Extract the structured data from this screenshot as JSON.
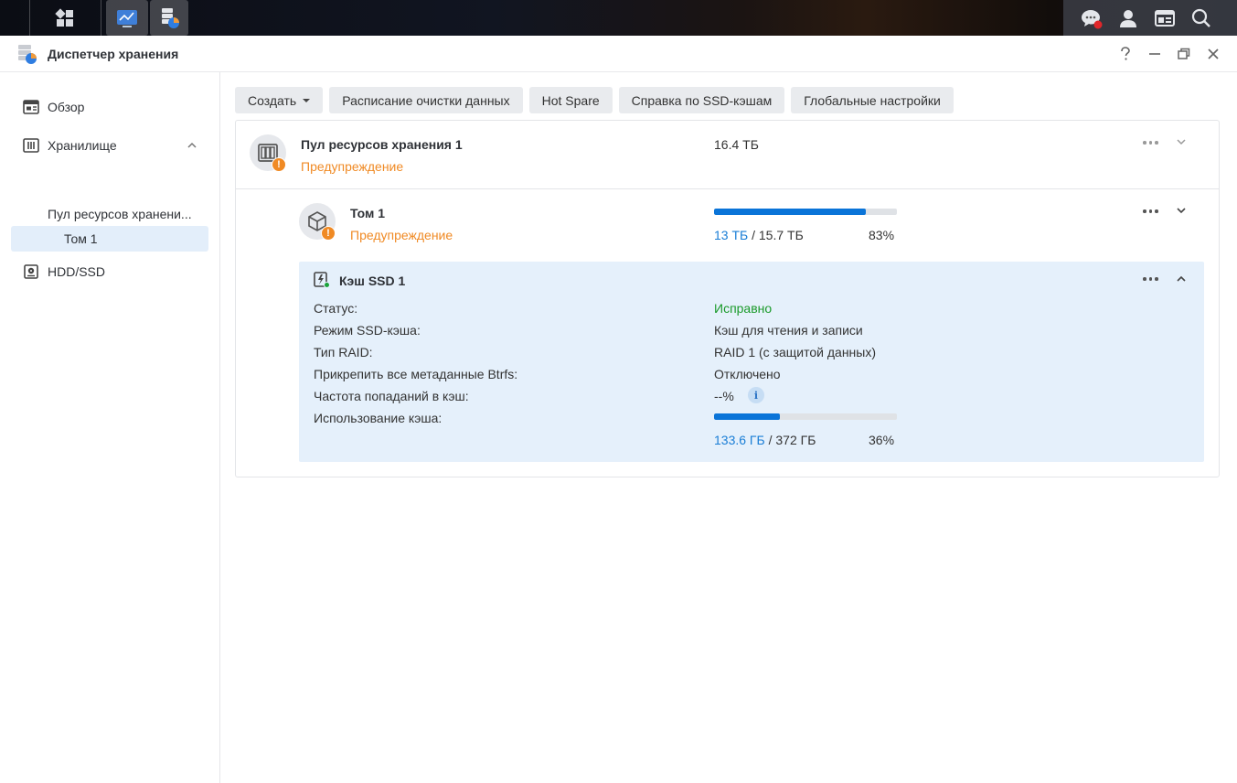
{
  "window": {
    "title": "Диспетчер хранения"
  },
  "sidebar": {
    "items": [
      {
        "label": "Обзор"
      },
      {
        "label": "Хранилище"
      },
      {
        "label": "Пул ресурсов хранени..."
      },
      {
        "label": "Том 1"
      },
      {
        "label": "HDD/SSD"
      }
    ]
  },
  "toolbar": {
    "create": "Создать",
    "scrub": "Расписание очистки данных",
    "hotspare": "Hot Spare",
    "ssd_help": "Справка по SSD-кэшам",
    "global": "Глобальные настройки"
  },
  "pool": {
    "name": "Пул ресурсов хранения 1",
    "status": "Предупреждение",
    "size": "16.4 ТБ"
  },
  "volume": {
    "name": "Том 1",
    "status": "Предупреждение",
    "used": "13 ТБ",
    "sep": " / ",
    "total": "15.7 ТБ",
    "percent_text": "83%",
    "percent": 83
  },
  "cache": {
    "name": "Кэш SSD 1",
    "rows": [
      {
        "label": "Статус:",
        "value": "Исправно"
      },
      {
        "label": "Режим SSD-кэша:",
        "value": "Кэш для чтения и записи"
      },
      {
        "label": "Тип RAID:",
        "value": "RAID 1 (с защитой данных)"
      },
      {
        "label": "Прикрепить все метаданные Btrfs:",
        "value": "Отключено"
      },
      {
        "label": "Частота попаданий в кэш:",
        "value": "--%"
      },
      {
        "label": "Использование кэша:",
        "value": ""
      }
    ],
    "used": "133.6 ГБ",
    "sep": " / ",
    "total": "372 ГБ",
    "percent_text": "36%",
    "percent": 36
  },
  "colors": {
    "accent": "#0a74d8",
    "warning": "#f08a24",
    "ok": "#1a9a2a",
    "selected_bg": "#e3eefa",
    "cache_bg": "#e5f0fb"
  }
}
